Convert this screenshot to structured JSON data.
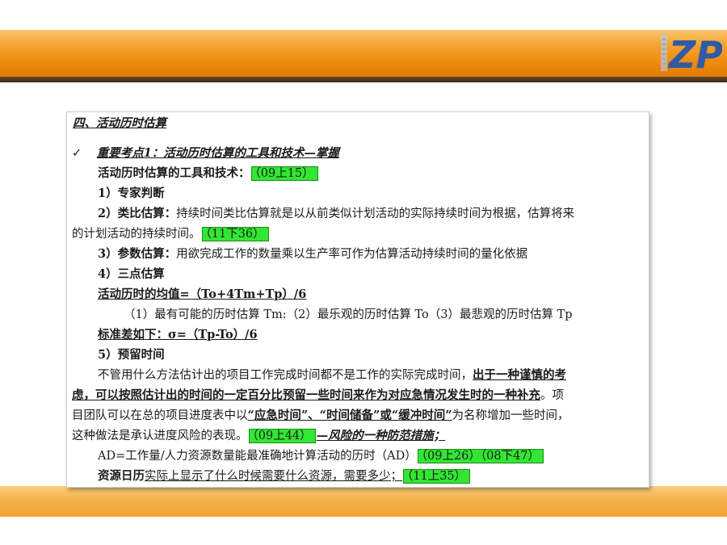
{
  "logo": {
    "text": "ZP"
  },
  "content": {
    "heading": "四、活动历时估算",
    "check_mark": "✓",
    "key_point": "重要考点1：活动历时估算的工具和技术—掌握",
    "l1": {
      "text": "活动历时估算的工具和技术：",
      "tag": "（09上15）"
    },
    "l2": "1）专家判断",
    "l3": {
      "label": "2）类比估算：",
      "text": "持续时间类比估算就是以从前类似计划活动的实际持续时间为根据，估算将来"
    },
    "l4": {
      "text": "的计划活动的持续时间。",
      "tag": "（11下36）"
    },
    "l5": {
      "label": "3）参数估算：",
      "text": "用欲完成工作的数量乘以生产率可作为估算活动持续时间的量化依据"
    },
    "l6": "4）三点估算",
    "l7": "活动历时的均值=（To+4Tm+Tp）/6",
    "l8": "（1）最有可能的历时估算 Tm:（2）最乐观的历时估算 To（3）最悲观的历时估算 Tp",
    "l9": "标准差如下：σ=（Tp-To）/6",
    "l10": "5）预留时间",
    "l11": {
      "text": "不管用什么方法估计出的项目工作完成时间都不是工作的实际完成时间，",
      "bold": "出于一种谨慎的考"
    },
    "l12": {
      "bold": "虑，可以按照估计出的时间的一定百分比预留一些时间来作为对应急情况发生时的一种补充",
      "text": "。项"
    },
    "l13": {
      "text1": "目团队可以在总的项目进度表中以",
      "bold": "“应急时间”、“时间储备”或“缓冲时间”",
      "text2": "为名称增加一些时间，"
    },
    "l14": {
      "text": "这种做法是承认进度风险的表现。",
      "tag": "（09上44）",
      "bold": "—风险的一种防范措施；"
    },
    "l15": {
      "text": "AD=工作量/人力资源数量能最准确地计算活动的历时（AD）",
      "tag": "（09上26）（08下47）"
    },
    "l16": {
      "label": "资源日历",
      "text": "实际上显示了什么时候需要什么资源，需要多少；",
      "tag": "（11上35）"
    }
  }
}
